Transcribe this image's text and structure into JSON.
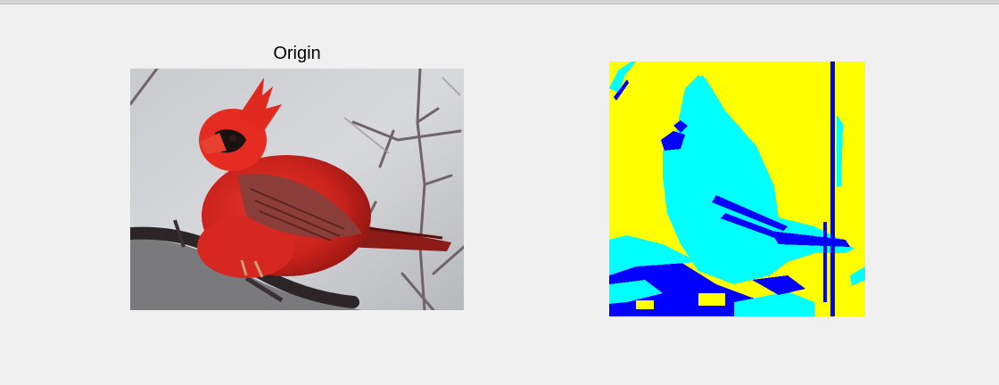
{
  "figure": {
    "left_axes": {
      "title": "Origin",
      "image": "red-cardinal-photo"
    },
    "right_axes": {
      "title": "",
      "image": "segmented-cardinal-map",
      "colors": {
        "background": "#ffff00",
        "bird": "#00ffff",
        "branch": "#0000ff"
      }
    }
  }
}
